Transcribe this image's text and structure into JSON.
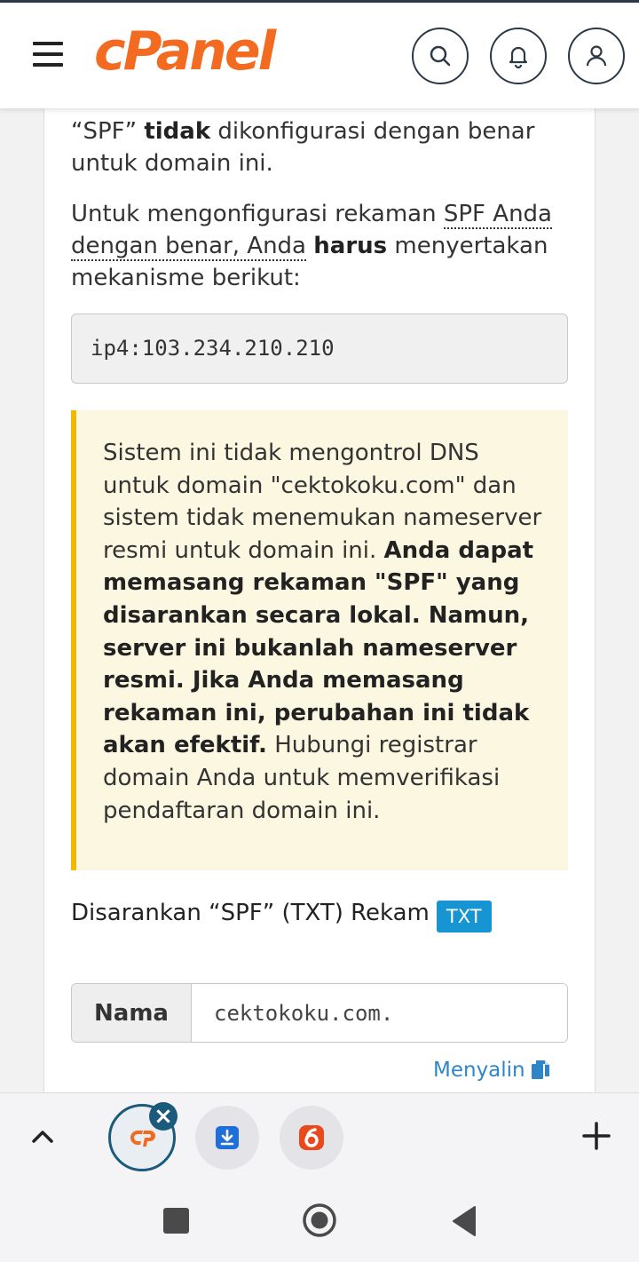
{
  "header": {
    "logo_text": "cPanel",
    "icons": [
      "menu-icon",
      "search-icon",
      "bell-icon",
      "user-icon"
    ]
  },
  "spf": {
    "p1_q": "“SPF”",
    "p1_bold": "tidak",
    "p1_rest": "dikonfigurasi dengan benar untuk domain ini.",
    "p2_start": "Untuk mengonfigurasi rekaman",
    "p2_link": "SPF Anda dengan benar, Anda",
    "p2_bold": "harus",
    "p2_end": "menyertakan mekanisme berikut:",
    "mechanism": "ip4:103.234.210.210"
  },
  "alert": {
    "part1": "Sistem ini tidak mengontrol DNS untuk domain \"cektokoku.com\" dan sistem tidak menemukan nameserver resmi untuk domain ini.",
    "bold": "Anda dapat memasang rekaman \"SPF\" yang disarankan secara lokal. Namun, server ini bukanlah nameserver resmi. Jika Anda memasang rekaman ini, perubahan ini tidak akan efektif.",
    "part2": "Hubungi registrar domain Anda untuk memverifikasi pendaftaran domain ini."
  },
  "record": {
    "title": "Disarankan “SPF” (TXT) Rekam",
    "badge": "TXT",
    "name_label": "Nama",
    "name_value": "cektokoku.com.",
    "copy_label": "Menyalin"
  },
  "colors": {
    "brand": "#f26b21",
    "alert_border": "#f5b800",
    "alert_bg": "#fcf7e0",
    "badge": "#1795d2",
    "link": "#2e86c9"
  }
}
